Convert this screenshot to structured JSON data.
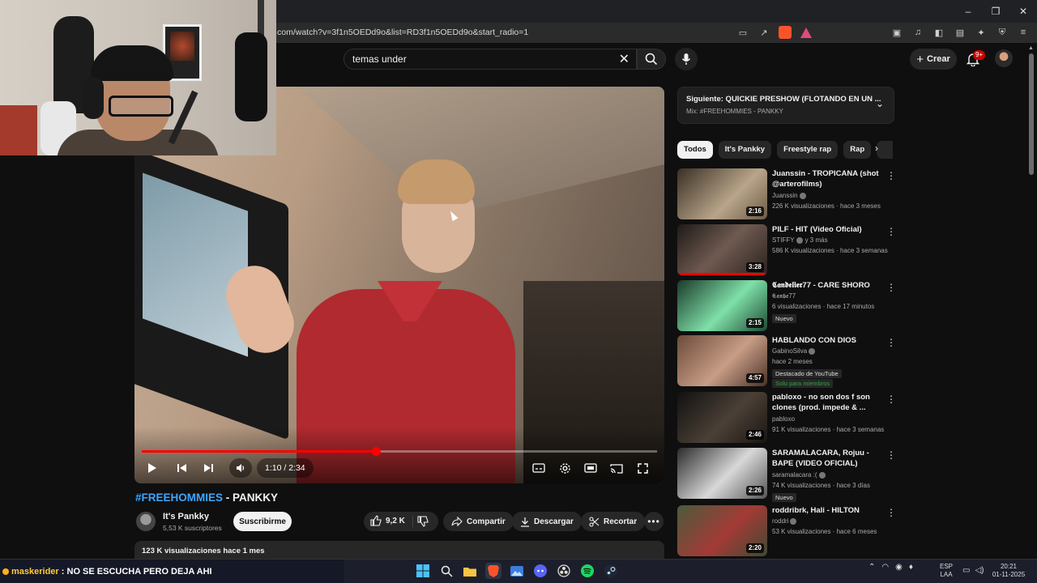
{
  "browser": {
    "url": "com/watch?v=3f1n5OEDd9o&list=RD3f1n5OEDd9o&start_radio=1"
  },
  "header": {
    "search_value": "temas under",
    "create_label": "Crear",
    "notification_count": "9+"
  },
  "player": {
    "time": "1:10 / 2:34",
    "progress_fraction": 0.455
  },
  "video": {
    "hashtag": "#FREEHOMMIES",
    "title_rest": " - PANKKY",
    "channel": "It's Pankky",
    "subscribers": "5,53 K suscriptores",
    "subscribe_label": "Suscribirme",
    "likes": "9,2 K",
    "share_label": "Compartir",
    "download_label": "Descargar",
    "clip_label": "Recortar",
    "views_date": "123 K visualizaciones  hace 1 mes"
  },
  "next": {
    "title": "Siguiente: QUICKIE PRESHOW (FLOTANDO EN UN ...",
    "mix": "Mix: #FREEHOMMIES - PANKKY"
  },
  "chips": [
    "Todos",
    "It's Pankky",
    "Freestyle rap",
    "Rap"
  ],
  "recommendations": [
    {
      "title": "Juanssin - TROPICANA (shot @arterofilms)",
      "channel": "Juanssin",
      "meta": "226 K visualizaciones · hace 3 meses",
      "duration": "2:16",
      "verified": true
    },
    {
      "title": "PILF - HIT (Video Oficial)",
      "channel": "STIFFY",
      "channel_extra": "y 3 más",
      "meta": "586 K visualizaciones · hace 3 semanas",
      "duration": "3:28",
      "verified": true,
      "watched": 1.0
    },
    {
      "title": "𝕮𝖆𝖓𝖉𝖊𝖑𝖎𝖊𝖗77 - CARE SHORO",
      "channel": "𝕮𝖆𝖓𝖇𝖊77",
      "meta": "6 visualizaciones · hace 17 minutos",
      "duration": "2:15",
      "badge": "Nuevo"
    },
    {
      "title": "HABLANDO CON DIOS",
      "channel": "GabinoSilva",
      "meta": "hace 2 meses",
      "duration": "4:57",
      "verified": true,
      "badge": "Destacado de YouTube",
      "members": "Solo para miembros"
    },
    {
      "title": "pabloxo - no son dos f son clones (prod. impede & ...",
      "channel": "pabloxo",
      "meta": "91 K visualizaciones · hace 3 semanas",
      "duration": "2:46"
    },
    {
      "title": "SARAMALACARA, Rojuu - BAPE (VIDEO OFICIAL)",
      "channel": "saramalacara :(",
      "meta": "74 K visualizaciones · hace 3 días",
      "duration": "2:26",
      "verified": true,
      "badge": "Nuevo"
    },
    {
      "title": "roddribrk, Hali - HILTON",
      "channel": "roddri",
      "meta": "53 K visualizaciones · hace 6 meses",
      "duration": "2:20",
      "verified": true
    }
  ],
  "taskbar": {
    "chat_user": "maskerider",
    "chat_message": " : NO SE ESCUCHA PERO DEJA AHI",
    "lang_top": "ESP",
    "lang_bottom": "LAA",
    "time": "20:21",
    "date": "01-11-2025"
  },
  "colors": {
    "accent": "#ff0000",
    "hashtag": "#3ea6ff",
    "background": "#0f0f0f",
    "members": "#2ba640"
  }
}
